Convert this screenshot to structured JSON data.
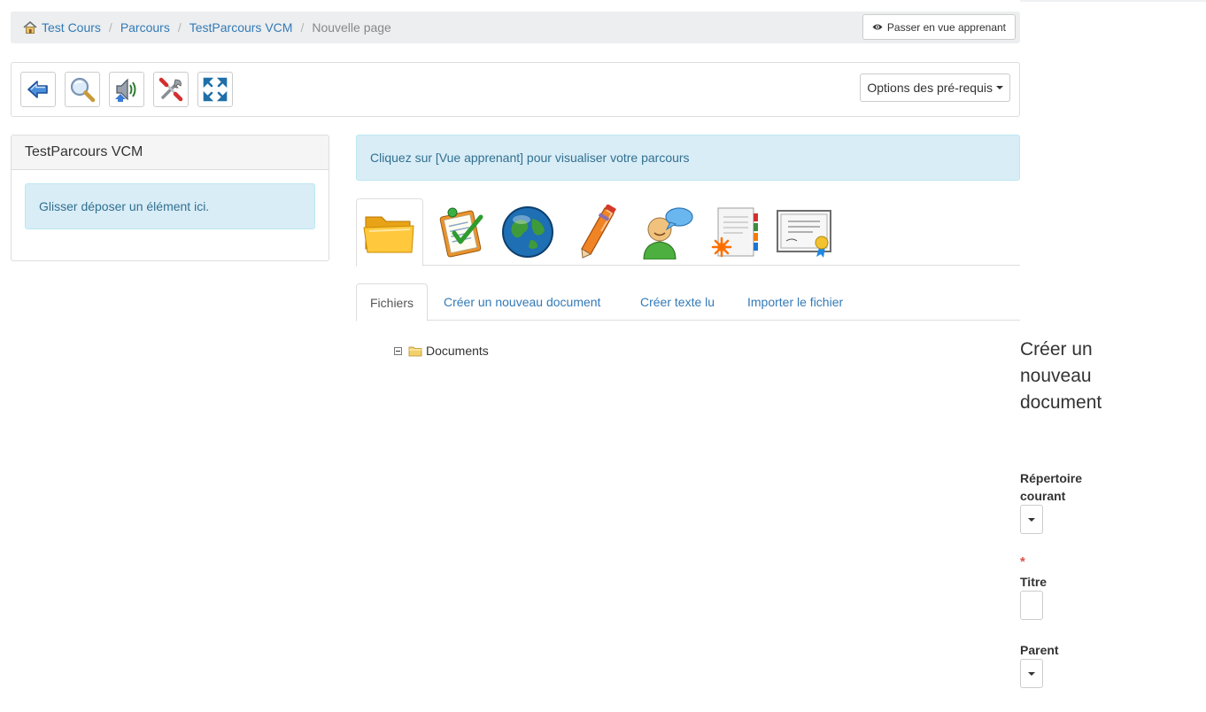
{
  "breadcrumb": {
    "items": [
      "Test Cours",
      "Parcours",
      "TestParcours VCM"
    ],
    "current": "Nouvelle page",
    "separator": "/"
  },
  "learner_button": {
    "label": "Passer en vue apprenant",
    "icon": "eye-icon"
  },
  "toolbar": {
    "buttons": [
      {
        "icon": "back-arrow-icon"
      },
      {
        "icon": "magnifier-icon"
      },
      {
        "icon": "speaker-icon"
      },
      {
        "icon": "tools-icon"
      },
      {
        "icon": "fullscreen-icon"
      }
    ],
    "prereq_label": "Options des pré-requis"
  },
  "left_panel": {
    "title": "TestParcours VCM",
    "drop_hint": "Glisser déposer un élément ici."
  },
  "info_message": "Cliquez sur [Vue apprenant] pour visualiser votre parcours",
  "resource_tabs": [
    {
      "icon": "folder-icon",
      "active": true
    },
    {
      "icon": "quiz-checklist-icon",
      "active": false
    },
    {
      "icon": "globe-link-icon",
      "active": false
    },
    {
      "icon": "pen-assignment-icon",
      "active": false
    },
    {
      "icon": "forum-user-icon",
      "active": false
    },
    {
      "icon": "notebook-icon",
      "active": false
    },
    {
      "icon": "certificate-icon",
      "active": false
    }
  ],
  "document_tabs": {
    "items": [
      "Fichiers",
      "Créer un nouveau document",
      "Créer texte lu",
      "Importer le fichier"
    ],
    "active_index": 0
  },
  "tree": {
    "root_label": "Documents"
  },
  "form": {
    "title": "Créer un nouveau document",
    "current_dir_label": "Répertoire courant",
    "required_mark": "*",
    "title_label": "Titre",
    "parent_label": "Parent"
  },
  "colors": {
    "link": "#337ab7",
    "info_bg": "#d9edf7",
    "info_text": "#31708f",
    "required": "#d9534f"
  }
}
